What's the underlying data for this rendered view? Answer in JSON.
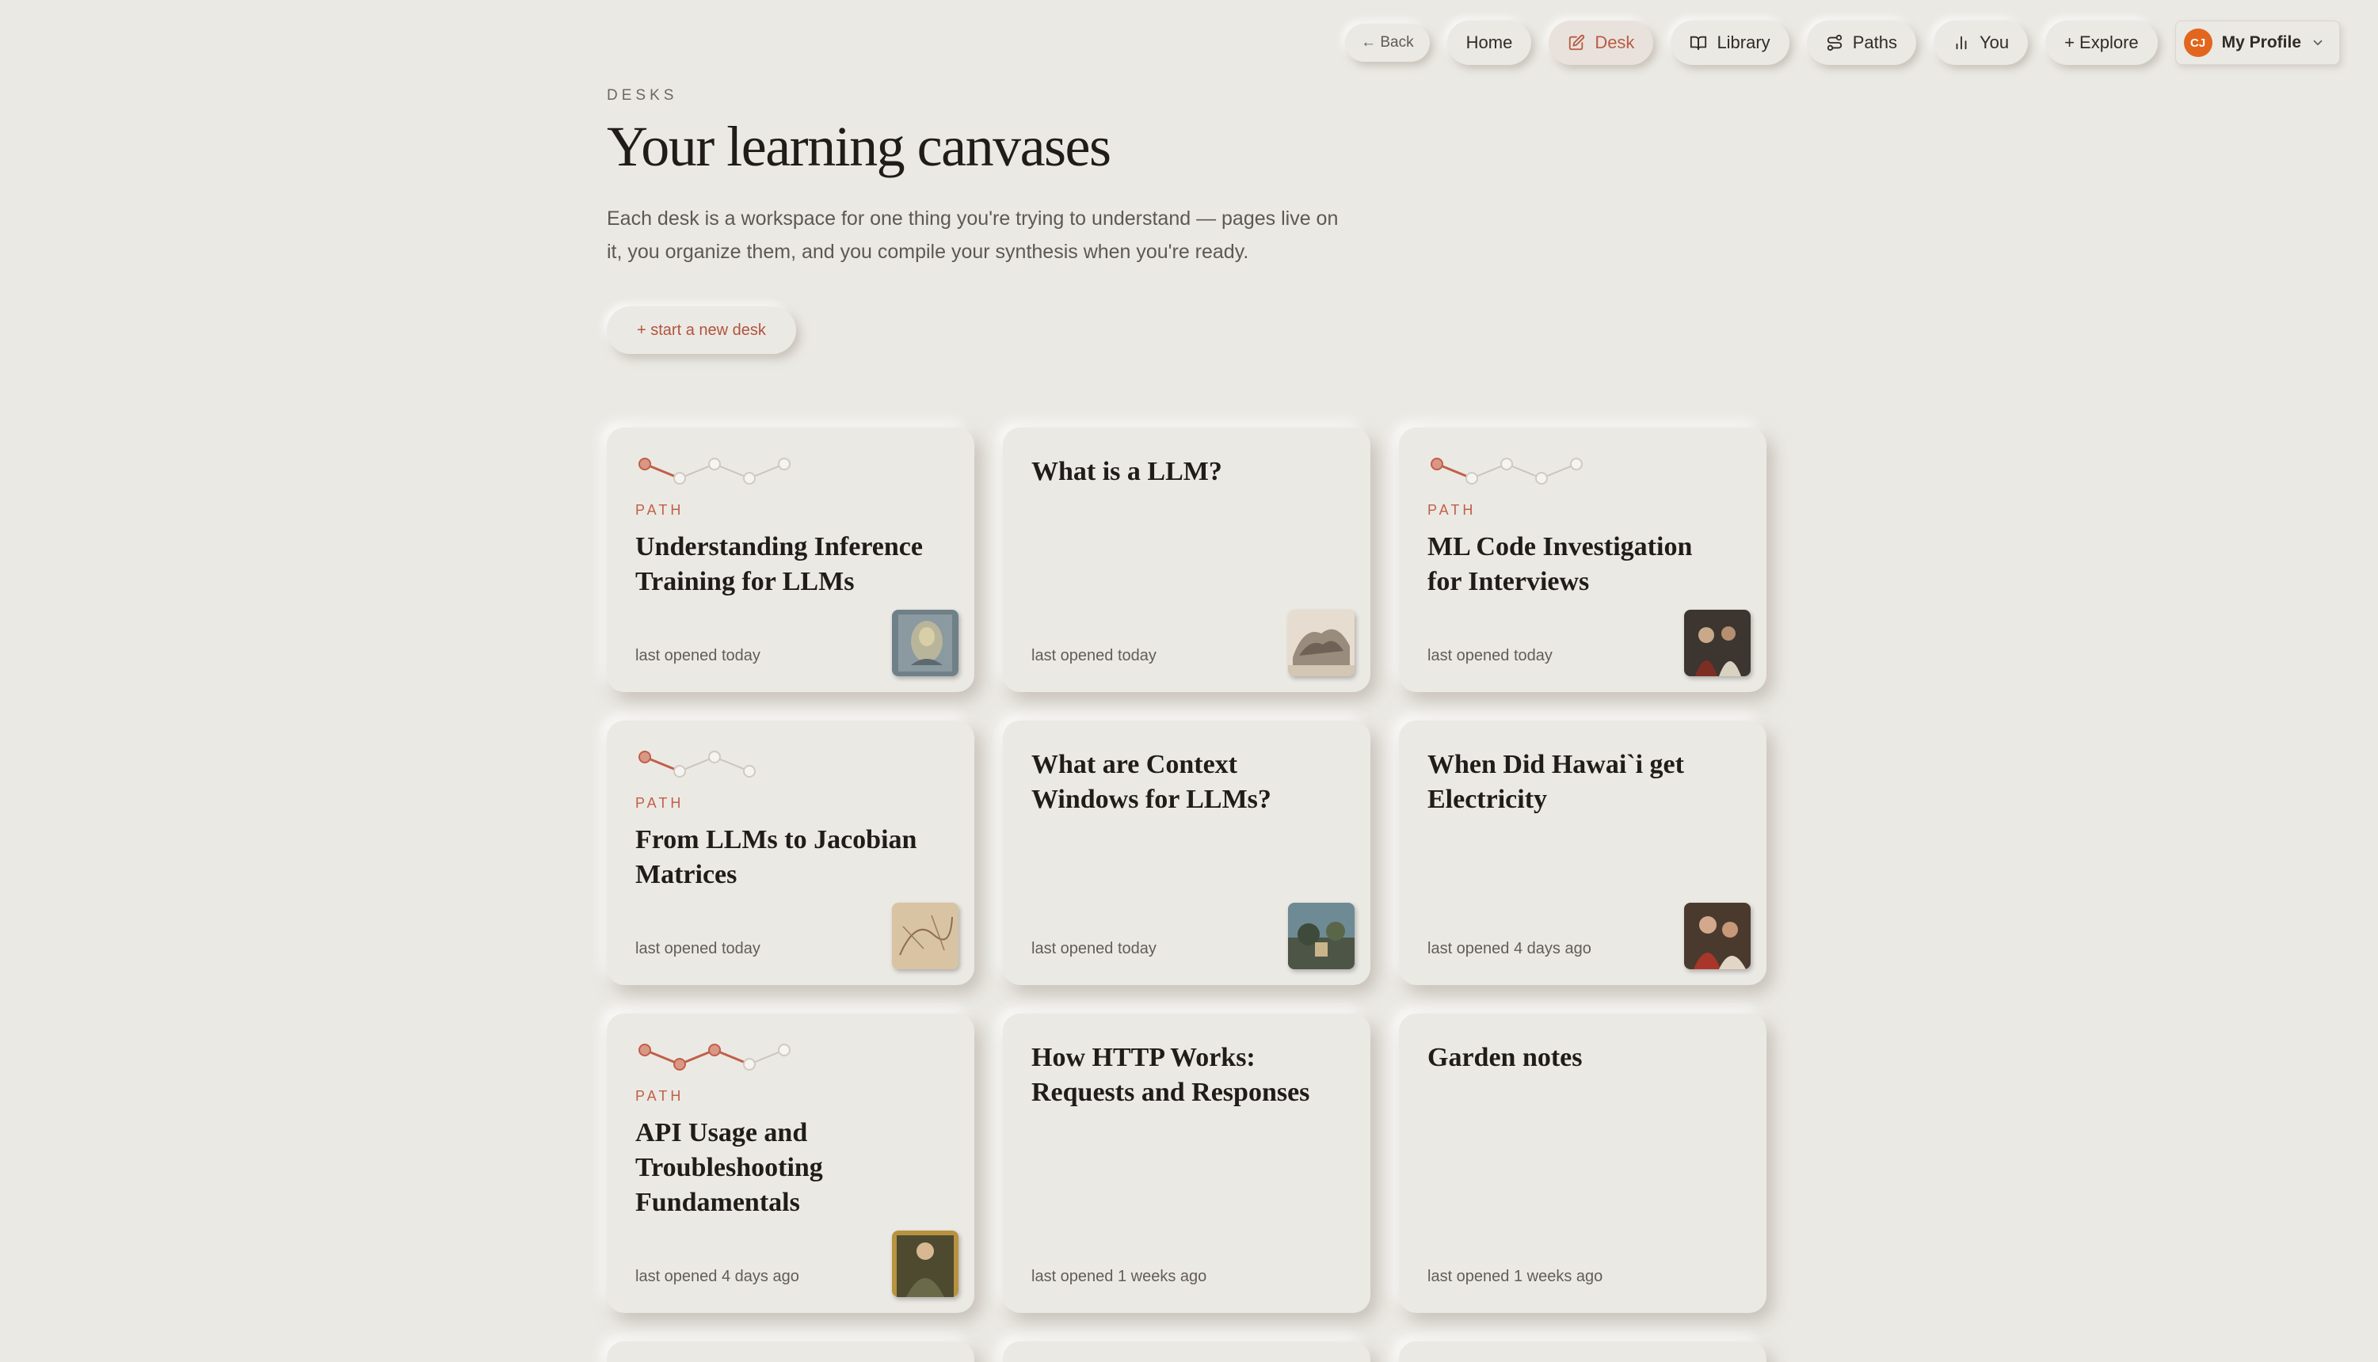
{
  "nav": {
    "back": "← Back",
    "home": "Home",
    "desk": "Desk",
    "library": "Library",
    "paths": "Paths",
    "you": "You",
    "explore": "+ Explore",
    "profile": {
      "initials": "CJ",
      "label": "My Profile"
    }
  },
  "header": {
    "eyebrow": "DESKS",
    "title": "Your learning canvases",
    "intro": "Each desk is a workspace for one thing you're trying to understand — pages live on it, you organize them, and you compile your synthesis when you're ready.",
    "new_desk": "+ start a new desk"
  },
  "colors": {
    "background": "#ebe9e4",
    "accent": "#c15f48",
    "avatar": "#e2661e"
  },
  "desks": [
    {
      "type": "path",
      "label": "PATH",
      "title": "Understanding Inference Training for LLMs",
      "meta": "last opened today",
      "progress_nodes": 5,
      "completed_nodes": 1,
      "thumbnail_icon": "painting-thumbnail-blue"
    },
    {
      "type": "desk",
      "title": "What is a LLM?",
      "meta": "last opened today",
      "thumbnail_icon": "painting-thumbnail-sketch"
    },
    {
      "type": "path",
      "label": "PATH",
      "title": "ML Code Investigation for Interviews",
      "meta": "last opened today",
      "progress_nodes": 5,
      "completed_nodes": 1,
      "thumbnail_icon": "painting-thumbnail-dark"
    },
    {
      "type": "path",
      "label": "PATH",
      "title": "From LLMs to Jacobian Matrices",
      "meta": "last opened today",
      "progress_nodes": 4,
      "completed_nodes": 1,
      "thumbnail_icon": "painting-thumbnail-parchment"
    },
    {
      "type": "desk",
      "title": "What are Context Windows for LLMs?",
      "meta": "last opened today",
      "thumbnail_icon": "painting-thumbnail-landscape"
    },
    {
      "type": "desk",
      "title": "When Did Hawai`i get Electricity",
      "meta": "last opened 4 days ago",
      "thumbnail_icon": "painting-thumbnail-figures"
    },
    {
      "type": "path",
      "label": "PATH",
      "title": "API Usage and Troubleshooting Fundamentals",
      "meta": "last opened 4 days ago",
      "progress_nodes": 5,
      "completed_nodes": 3,
      "thumbnail_icon": "painting-thumbnail-portrait"
    },
    {
      "type": "desk",
      "title": "How HTTP Works: Requests and Responses",
      "meta": "last opened 1 weeks ago"
    },
    {
      "type": "desk",
      "title": "Garden notes",
      "meta": "last opened 1 weeks ago"
    }
  ]
}
